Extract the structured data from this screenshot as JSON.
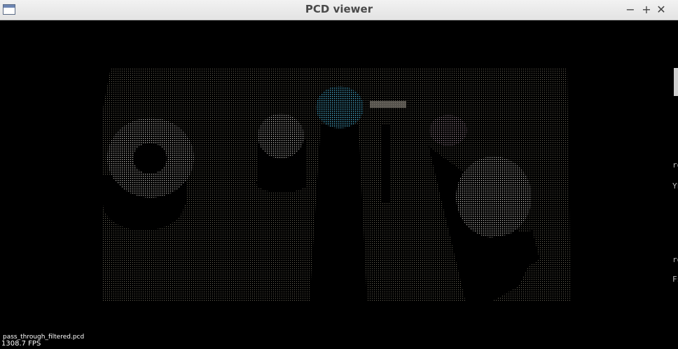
{
  "window": {
    "title": "PCD viewer",
    "controls": {
      "minimize": "−",
      "maximize": "+",
      "close": "✕"
    }
  },
  "viewer": {
    "filename": "pass_through_filtered.pcd",
    "fps_text": "1308.7 FPS",
    "background_color": "#000000"
  },
  "right_edge_fragments": [
    "ro",
    "YF",
    "ro",
    "Fs"
  ]
}
